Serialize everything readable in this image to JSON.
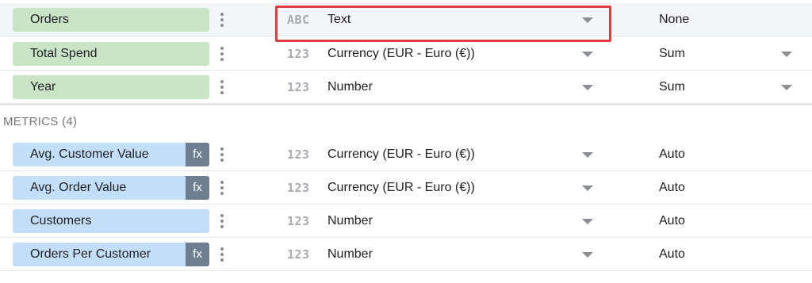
{
  "dimensions": [
    {
      "name": "Orders",
      "type_icon": "ABC",
      "type": "Text",
      "aggregation": "None",
      "agg_dropdown": false,
      "highlighted": true
    },
    {
      "name": "Total Spend",
      "type_icon": "123",
      "type": "Currency (EUR - Euro (€))",
      "aggregation": "Sum",
      "agg_dropdown": true
    },
    {
      "name": "Year",
      "type_icon": "123",
      "type": "Number",
      "aggregation": "Sum",
      "agg_dropdown": true
    }
  ],
  "metrics_header": "METRICS (4)",
  "metrics": [
    {
      "name": "Avg. Customer Value",
      "formula": true,
      "fx_label": "fx",
      "type_icon": "123",
      "type": "Currency (EUR - Euro (€))",
      "aggregation": "Auto"
    },
    {
      "name": "Avg. Order Value",
      "formula": true,
      "fx_label": "fx",
      "type_icon": "123",
      "type": "Currency (EUR - Euro (€))",
      "aggregation": "Auto"
    },
    {
      "name": "Customers",
      "formula": false,
      "type_icon": "123",
      "type": "Number",
      "aggregation": "Auto"
    },
    {
      "name": "Orders Per Customer",
      "formula": true,
      "fx_label": "fx",
      "type_icon": "123",
      "type": "Number",
      "aggregation": "Auto"
    }
  ],
  "icons": {
    "more": "more-vert-icon",
    "dropdown": "caret-down-icon",
    "text_type": "abc-type-icon",
    "number_type": "123-type-icon"
  },
  "colors": {
    "dimension_chip": "#c9e5c6",
    "metric_chip": "#c3def8",
    "fx_badge": "#6e7f91",
    "highlight_border": "#e0393e"
  }
}
